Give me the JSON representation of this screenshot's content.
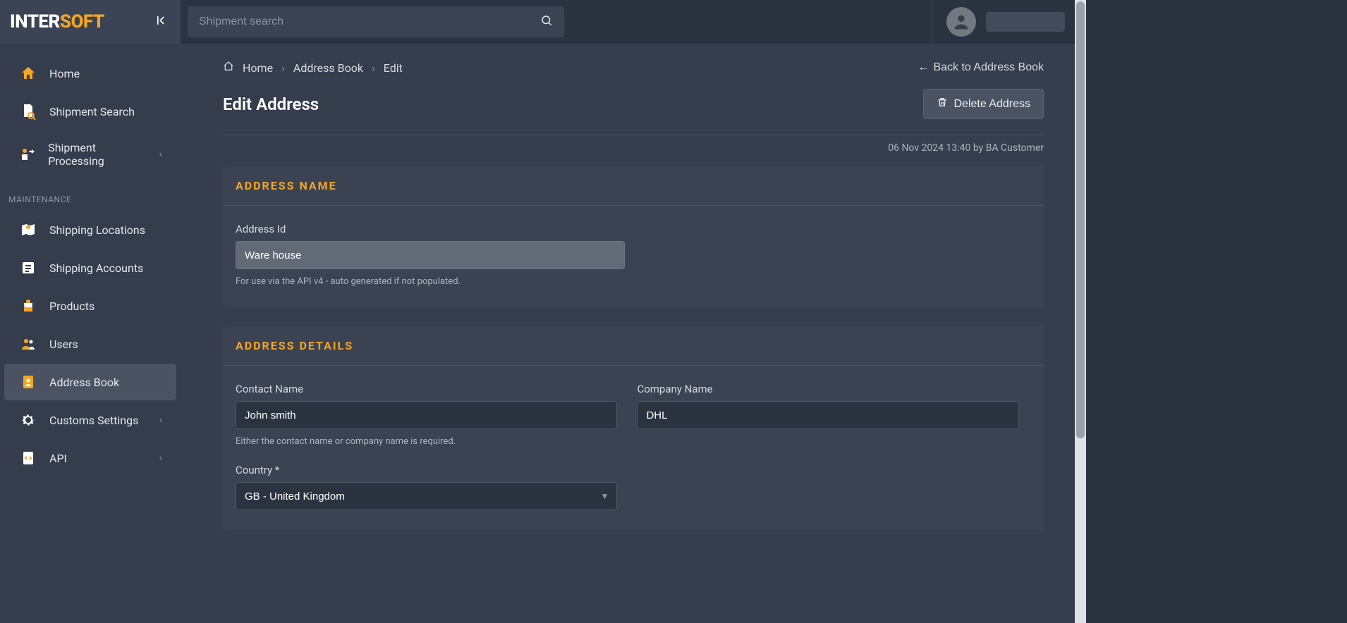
{
  "brand": {
    "part1": "INTER",
    "part2": "SOFT"
  },
  "search": {
    "placeholder": "Shipment search"
  },
  "sidebar": {
    "nav": [
      {
        "label": "Home"
      },
      {
        "label": "Shipment Search"
      },
      {
        "label": "Shipment Processing"
      }
    ],
    "section": "MAINTENANCE",
    "maint": [
      {
        "label": "Shipping Locations"
      },
      {
        "label": "Shipping Accounts"
      },
      {
        "label": "Products"
      },
      {
        "label": "Users"
      },
      {
        "label": "Address Book"
      },
      {
        "label": "Customs Settings"
      },
      {
        "label": "API"
      }
    ]
  },
  "breadcrumb": {
    "home": "Home",
    "mid": "Address Book",
    "leaf": "Edit"
  },
  "back_link": "Back to Address Book",
  "page_title": "Edit Address",
  "delete_label": "Delete Address",
  "meta": "06 Nov 2024 13:40 by BA Customer",
  "panel1": {
    "title": "ADDRESS NAME",
    "address_id_label": "Address Id",
    "address_id_value": "Ware house",
    "address_id_hint": "For use via the API v4 - auto generated if not populated."
  },
  "panel2": {
    "title": "ADDRESS DETAILS",
    "contact_label": "Contact Name",
    "contact_value": "John smith",
    "contact_hint": "Either the contact name or company name is required.",
    "company_label": "Company Name",
    "company_value": "DHL",
    "country_label": "Country *",
    "country_value": "GB - United Kingdom"
  }
}
